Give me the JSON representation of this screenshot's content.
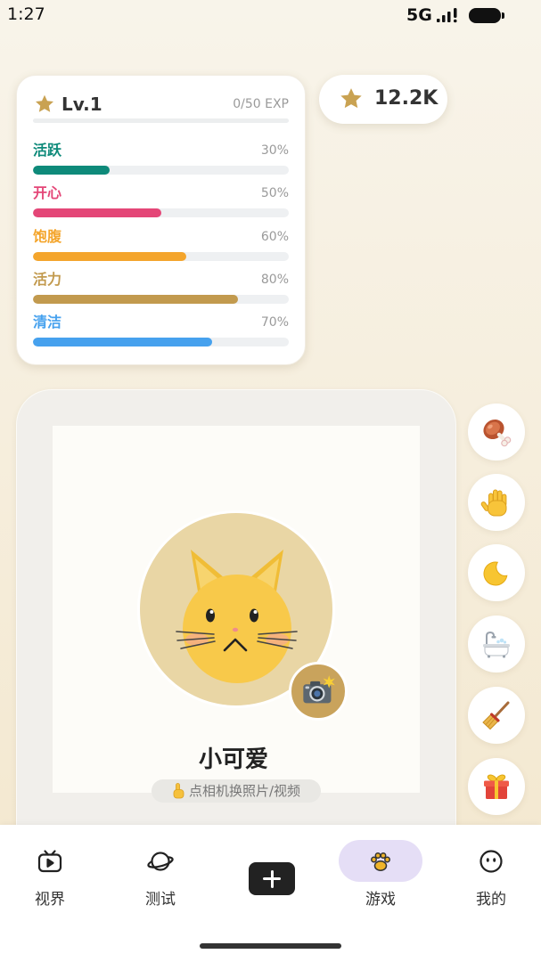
{
  "status_bar": {
    "time": "1:27",
    "network": "5G",
    "signal_icon": "signal-icon",
    "battery_icon": "battery-icon"
  },
  "level_card": {
    "icon": "star-icon",
    "level": "Lv.1",
    "exp_text": "0/50 EXP",
    "exp_progress": 0,
    "stats": [
      {
        "label": "活跃",
        "percent_text": "30%",
        "value": 0.3,
        "color": "#0e8a7a"
      },
      {
        "label": "开心",
        "percent_text": "50%",
        "value": 0.5,
        "color": "#e44677"
      },
      {
        "label": "饱腹",
        "percent_text": "60%",
        "value": 0.6,
        "color": "#f4a52c"
      },
      {
        "label": "活力",
        "percent_text": "80%",
        "value": 0.8,
        "color": "#c29a4e"
      },
      {
        "label": "清洁",
        "percent_text": "70%",
        "value": 0.7,
        "color": "#46a1ee"
      }
    ]
  },
  "coins": {
    "icon": "star-icon",
    "amount": "12.2K"
  },
  "pet": {
    "avatar_icon": "cat-face-icon",
    "camera_icon": "camera-icon",
    "name": "小可爱",
    "hint_icon": "pointing-up-icon",
    "hint": "点相机换照片/视频"
  },
  "actions": [
    {
      "icon": "meat-icon"
    },
    {
      "icon": "hand-icon"
    },
    {
      "icon": "moon-icon"
    },
    {
      "icon": "bathtub-icon"
    },
    {
      "icon": "broom-icon"
    },
    {
      "icon": "gift-icon"
    }
  ],
  "nav": {
    "items": [
      {
        "label": "视界",
        "icon": "tv-icon"
      },
      {
        "label": "测试",
        "icon": "planet-icon"
      },
      {
        "icon": "plus-icon"
      },
      {
        "label": "游戏",
        "icon": "paw-icon",
        "active": true
      },
      {
        "label": "我的",
        "icon": "smiley-icon"
      }
    ]
  },
  "colors": {
    "star": "#c9a252",
    "active_tab": "#e5def6",
    "camera_badge": "#c9a35c",
    "avatar_bg": "#e9d6a5"
  }
}
